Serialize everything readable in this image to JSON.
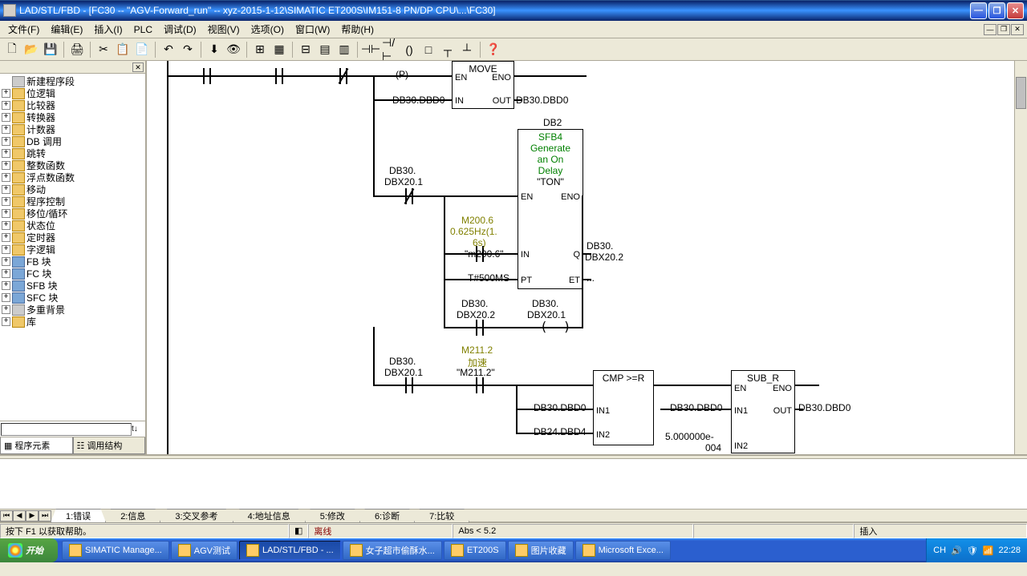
{
  "titlebar": {
    "title": "LAD/STL/FBD  - [FC30 -- \"AGV-Forward_run\" -- xyz-2015-1-12\\SIMATIC ET200S\\IM151-8 PN/DP CPU\\...\\FC30]"
  },
  "menu": {
    "file": "文件(F)",
    "edit": "编辑(E)",
    "insert": "插入(I)",
    "plc": "PLC",
    "debug": "调试(D)",
    "view": "视图(V)",
    "options": "选项(O)",
    "window": "窗口(W)",
    "help": "帮助(H)"
  },
  "tree": {
    "root": "新建程序段",
    "items": [
      "位逻辑",
      "比较器",
      "转换器",
      "计数器",
      "DB 调用",
      "跳转",
      "整数函数",
      "浮点数函数",
      "移动",
      "程序控制",
      "移位/循环",
      "状态位",
      "定时器",
      "字逻辑",
      "FB 块",
      "FC 块",
      "SFB 块",
      "SFC 块",
      "多重背景",
      "库"
    ]
  },
  "sidetabs": {
    "t1": "程序元素",
    "t2": "调用结构"
  },
  "canvas": {
    "move": {
      "title": "MOVE",
      "en": "EN",
      "eno": "ENO",
      "in": "IN",
      "out": "OUT",
      "in_val": "DB30.DBD0",
      "out_val": "DB30.DBD0",
      "p": "(P)"
    },
    "sfb4": {
      "inst": "DB2",
      "name": "SFB4",
      "desc1": "Generate",
      "desc2": "an On",
      "desc3": "Delay",
      "type": "\"TON\"",
      "en": "EN",
      "eno": "ENO",
      "in": "IN",
      "q": "Q",
      "pt": "PT",
      "et": "ET",
      "cond1a": "DB30.",
      "cond1b": "DBX20.1",
      "m200a": "M200.6",
      "m200b": "0.625Hz(1.",
      "m200c": "6s)",
      "m200d": "\"m200.6\"",
      "pt_val": "T#500MS",
      "q_a": "DB30.",
      "q_b": "DBX20.2",
      "et_val": "...",
      "row2_c1a": "DB30.",
      "row2_c1b": "DBX20.2",
      "row2_c2a": "DB30.",
      "row2_c2b": "DBX20.1"
    },
    "row3": {
      "c1a": "DB30.",
      "c1b": "DBX20.1",
      "m211a": "M211.2",
      "m211b": "加速",
      "m211c": "\"M211.2\""
    },
    "cmp": {
      "title": "CMP >=R",
      "in1": "IN1",
      "in2": "IN2",
      "in1_val": "DB30.DBD0",
      "in2_val": "DB24.DBD4"
    },
    "sub": {
      "title": "SUB_R",
      "en": "EN",
      "eno": "ENO",
      "in1": "IN1",
      "in2": "IN2",
      "out": "OUT",
      "in1_val": "DB30.DBD0",
      "in2a": "5.000000e-",
      "in2b": "004",
      "out_val": "DB30.DBD0"
    }
  },
  "bottom_tabs": [
    "1:错误",
    "2:信息",
    "3:交叉参考",
    "4:地址信息",
    "5:修改",
    "6:诊断",
    "7:比较"
  ],
  "status": {
    "help": "按下 F1 以获取帮助。",
    "offline": "离线",
    "abs": "Abs < 5.2",
    "insert": "插入"
  },
  "taskbar": {
    "start": "开始",
    "tasks": [
      "SIMATIC Manage...",
      "AGV测试",
      "LAD/STL/FBD  - ...",
      "女子超市偷酥水...",
      "ET200S",
      "图片收藏",
      "Microsoft Exce..."
    ],
    "lang": "CH",
    "clock": "22:28"
  }
}
